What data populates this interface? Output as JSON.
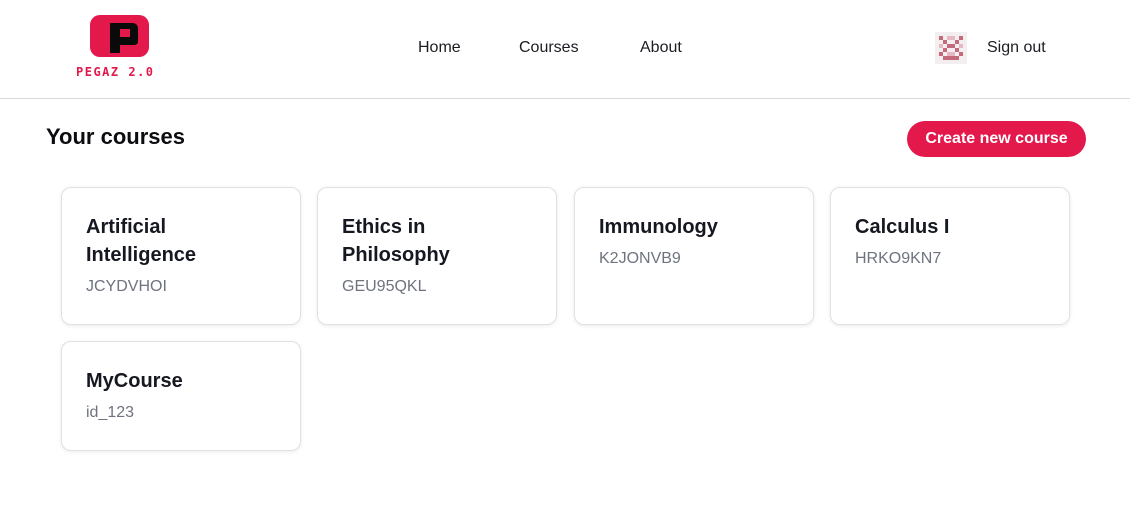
{
  "header": {
    "logo_text": "PEGAZ 2.0",
    "nav": [
      {
        "label": "Home"
      },
      {
        "label": "Courses"
      },
      {
        "label": "About"
      }
    ],
    "sign_out_label": "Sign out"
  },
  "main": {
    "title": "Your courses",
    "create_button_label": "Create new course",
    "courses": [
      {
        "title": "Artificial Intelligence",
        "code": "JCYDVHOI"
      },
      {
        "title": "Ethics in Philosophy",
        "code": "GEU95QKL"
      },
      {
        "title": "Immunology",
        "code": "K2JONVB9"
      },
      {
        "title": "Calculus I",
        "code": "HRKO9KN7"
      },
      {
        "title": "MyCourse",
        "code": "id_123"
      }
    ]
  },
  "colors": {
    "accent": "#e3184b",
    "avatar": "#c46a7a"
  },
  "icons": {
    "logo": "pegaz-logo-icon",
    "avatar": "pixel-identicon-avatar"
  }
}
